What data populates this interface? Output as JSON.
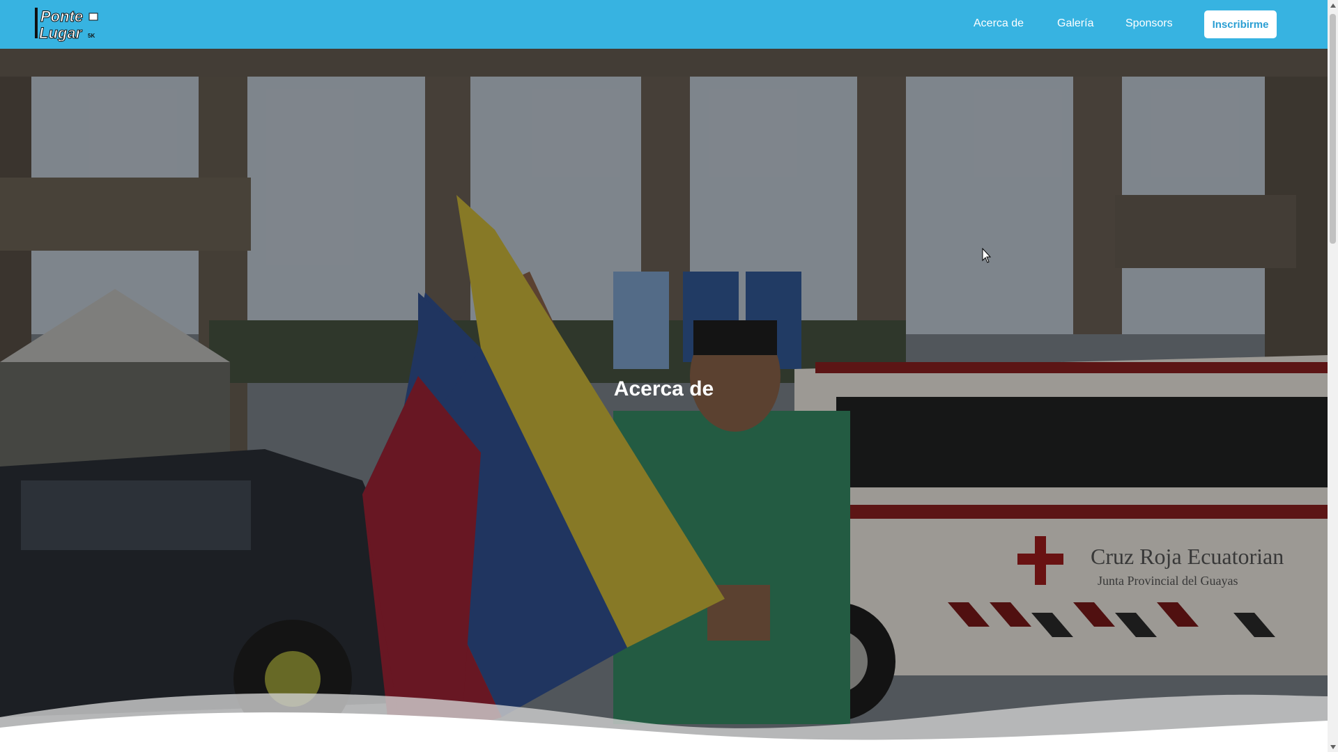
{
  "brand": {
    "logo_text_line1": "Ponte",
    "logo_text_line2": "Lugar",
    "logo_badge": "5K"
  },
  "nav": {
    "items": [
      {
        "label": "Acerca de"
      },
      {
        "label": "Galería"
      },
      {
        "label": "Sponsors"
      }
    ],
    "cta_label": "Inscribirme"
  },
  "hero": {
    "title": "Acerca de",
    "background_sign_line1": "Cruz Roja Ecuatorian",
    "background_sign_line2": "Junta Provincial del Guayas"
  },
  "colors": {
    "header_bg": "#37b3e1",
    "cta_text": "#2b9fd3",
    "overlay": "rgba(0,0,0,0.45)"
  },
  "icons": [
    "cursor-icon",
    "scroll-up-icon",
    "scroll-down-icon"
  ]
}
